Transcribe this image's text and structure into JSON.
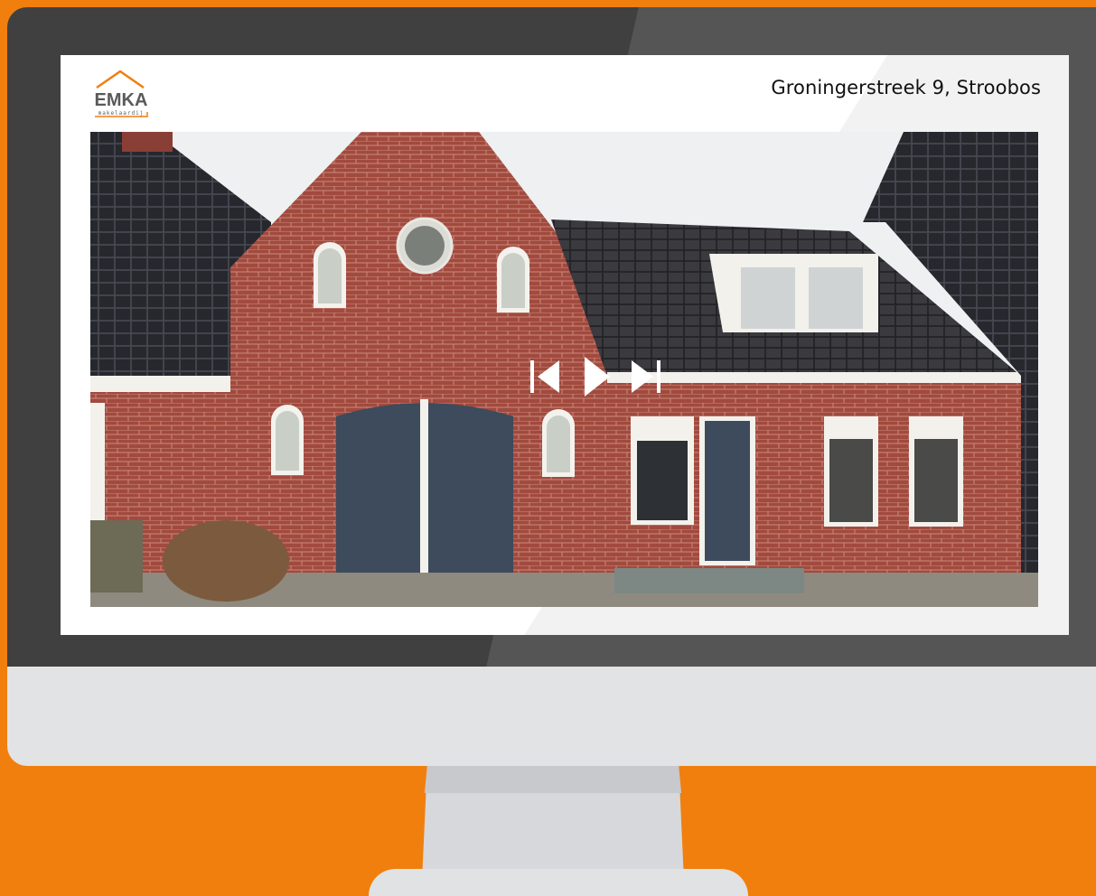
{
  "logo": {
    "brand": "EMKA",
    "sub": "makelaardij"
  },
  "listing": {
    "address": "Groningerstreek 9, Stroobos"
  },
  "viewer": {
    "controls": [
      {
        "name": "previous-icon"
      },
      {
        "name": "play-icon"
      },
      {
        "name": "next-icon"
      }
    ]
  },
  "colors": {
    "background": "#f07f0e",
    "bezel": "#404040",
    "chin": "#e2e3e5",
    "brick": "#a24a3e",
    "roof": "#2f2e33",
    "door": "#3d4b5c"
  }
}
